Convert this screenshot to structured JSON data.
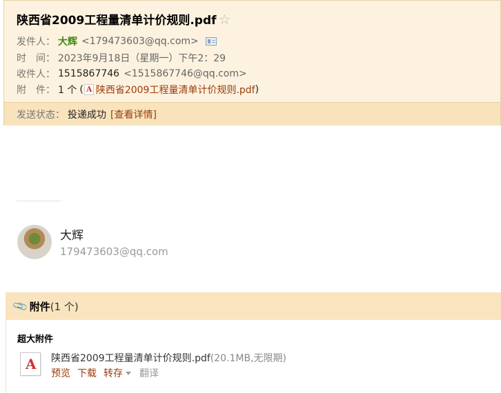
{
  "header": {
    "subject": "陕西省2009工程量清单计价规则.pdf",
    "star_icon": "star-outline-icon",
    "sender_label": "发件人：",
    "sender_name": "大辉",
    "sender_email": "<179473603@qq.com>",
    "time_label": "时　间：",
    "time_value": "2023年9月18日（星期一）下午2：29",
    "recipient_label": "收件人：",
    "recipient_name": "1515867746",
    "recipient_email": "<1515867746@qq.com>",
    "attachment_label": "附　件：",
    "attachment_count": "1 个",
    "attachment_open": "(",
    "attachment_name": "陕西省2009工程量清单计价规则.pdf",
    "attachment_close": ")"
  },
  "status": {
    "label": "发送状态：",
    "value": "投递成功",
    "detail_link": "[查看详情]"
  },
  "signature": {
    "name": "大辉",
    "email": "179473603@qq.com"
  },
  "attachments": {
    "title": "附件",
    "count": "(1 个)",
    "section_label": "超大附件",
    "file": {
      "name": "陕西省2009工程量清单计价规则.pdf",
      "meta": "(20.1MB,无限期)"
    },
    "actions": {
      "preview": "预览",
      "download": "下载",
      "transfer": "转存",
      "translate": "翻译"
    }
  },
  "colors": {
    "header_bg": "#fdf2df",
    "status_bg": "#f8e3bd",
    "link": "#9b3b0b",
    "sender_name": "#3e8a15"
  }
}
